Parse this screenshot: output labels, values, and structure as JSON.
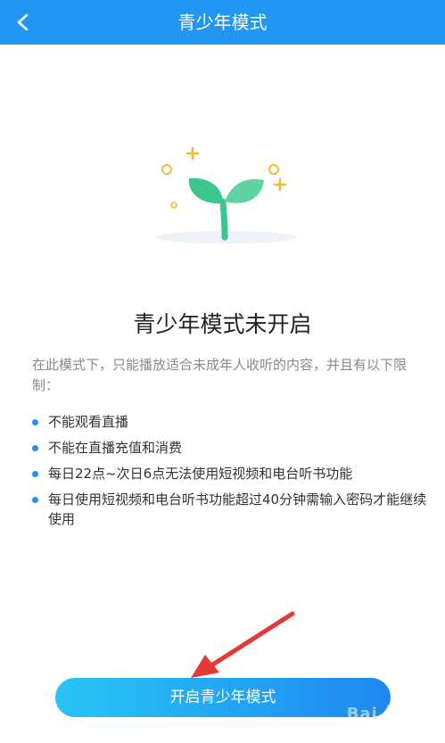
{
  "header": {
    "title": "青少年模式",
    "back_icon": "chevron-left-icon"
  },
  "illustration": {
    "icon": "sprout-icon",
    "leaf_color": "#3cc58c",
    "accent_color": "#f4b93a"
  },
  "main": {
    "heading": "青少年模式未开启",
    "intro": "在此模式下，只能播放适合未成年人收听的内容，并且有以下限制：",
    "rules": [
      "不能观看直播",
      "不能在直播充值和消费",
      "每日22点~次日6点无法使用短视频和电台听书功能",
      "每日使用短视频和电台听书功能超过40分钟需输入密码才能继续使用"
    ]
  },
  "cta": {
    "label": "开启青少年模式"
  },
  "watermark": {
    "text": "Bai 经验"
  },
  "colors": {
    "topbar": "#2196f3",
    "bullet": "#2a8ef0",
    "button_start": "#29c4f6",
    "button_end": "#1e88f0",
    "arrow": "#e53935"
  }
}
